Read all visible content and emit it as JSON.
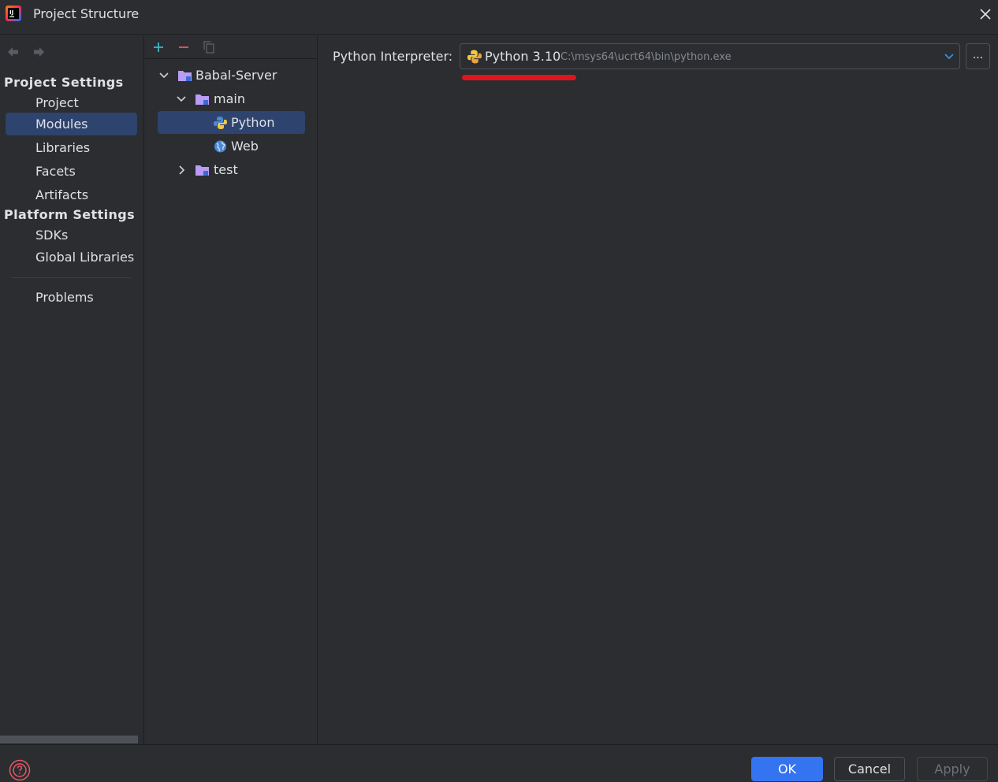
{
  "window": {
    "title": "Project Structure"
  },
  "nav": {
    "project_settings_header": "Project Settings",
    "platform_settings_header": "Platform Settings",
    "items": [
      {
        "label": "Project"
      },
      {
        "label": "Modules",
        "selected": true
      },
      {
        "label": "Libraries"
      },
      {
        "label": "Facets"
      },
      {
        "label": "Artifacts"
      },
      {
        "label": "SDKs"
      },
      {
        "label": "Global Libraries"
      },
      {
        "label": "Problems"
      }
    ]
  },
  "tree": {
    "toolbar": [
      "add-icon",
      "remove-icon",
      "copy-icon"
    ],
    "nodes": [
      {
        "label": "Babal-Server",
        "expanded": true
      },
      {
        "label": "main",
        "expanded": true
      },
      {
        "label": "Python",
        "selected": true
      },
      {
        "label": "Web"
      },
      {
        "label": "test",
        "expanded": false
      }
    ]
  },
  "interpreter": {
    "label": "Python Interpreter:",
    "name": "Python 3.10",
    "path": "C:\\msys64\\ucrt64\\bin\\python.exe",
    "more_label": "..."
  },
  "buttons": {
    "ok": "OK",
    "cancel": "Cancel",
    "apply": "Apply"
  },
  "colors": {
    "accent": "#3574f0",
    "selection": "#2e436e",
    "annotation_red": "#e0141c"
  }
}
